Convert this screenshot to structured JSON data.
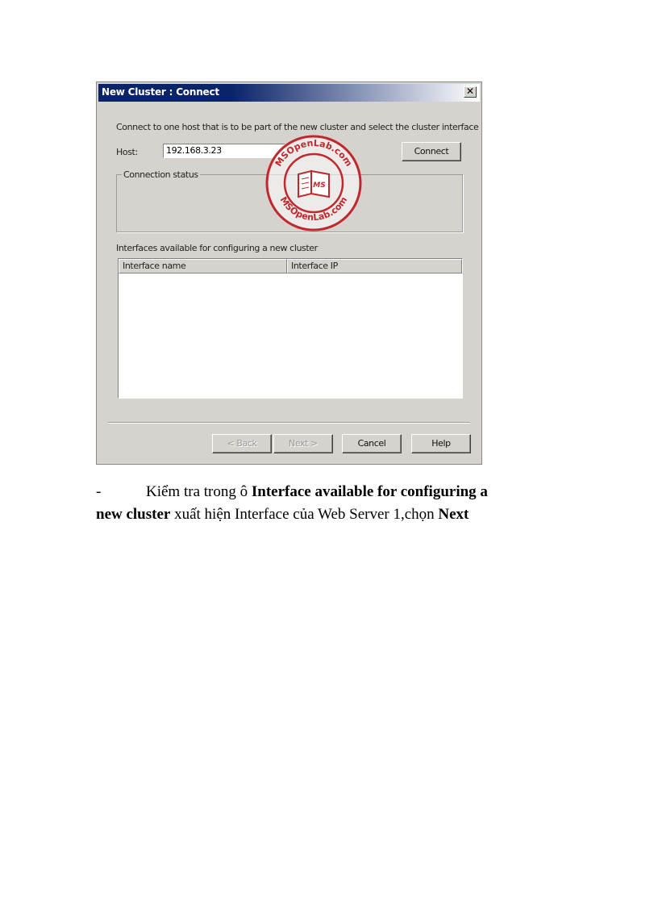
{
  "dialog": {
    "title": "New Cluster : Connect",
    "close_glyph": "✕",
    "instruction": "Connect to one host that is to be part of the new cluster and select the cluster interface",
    "host_label": "Host:",
    "host_value": "192.168.3.23",
    "connect_label": "Connect",
    "connection_status_label": "Connection status",
    "interfaces_label": "Interfaces available for configuring a new cluster",
    "columns": [
      "Interface name",
      "Interface IP"
    ],
    "rows": [],
    "buttons": {
      "back": "< Back",
      "next": "Next >",
      "cancel": "Cancel",
      "help": "Help"
    }
  },
  "watermark": {
    "text": "MSOpenLab.com",
    "badge": "MS",
    "color": "#c0282e"
  },
  "body_text": {
    "bullet": "-",
    "line1_prefix": "Kiểm tra trong ô ",
    "line1_bold": "Interface available for configuring a",
    "line2_bold": "new cluster",
    "line2_middle": " xuất hiện Interface của Web Server 1,chọn ",
    "line2_bold_end": "Next"
  }
}
